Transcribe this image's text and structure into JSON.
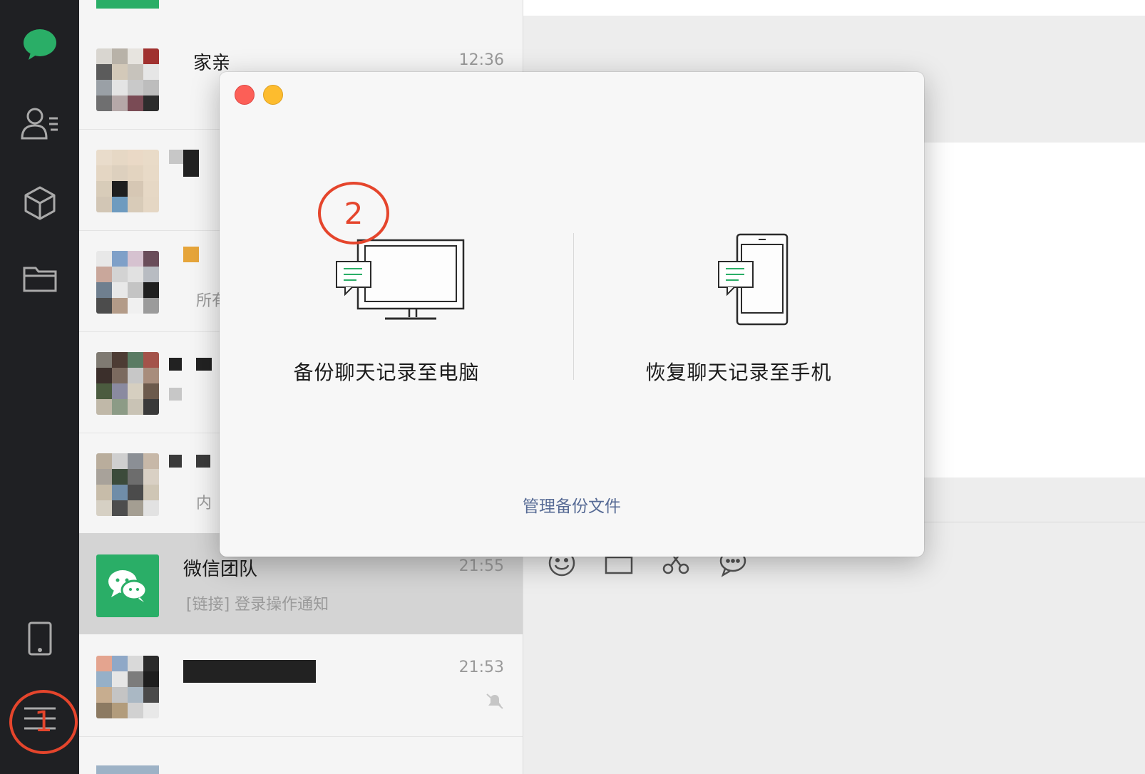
{
  "chat_list": [
    {
      "name": "家亲",
      "time": "12:36",
      "preview": ""
    },
    {
      "name": "",
      "time": "",
      "preview": ""
    },
    {
      "name": "",
      "time": "",
      "preview": "所有"
    },
    {
      "name": "",
      "time": "",
      "preview": ""
    },
    {
      "name": "",
      "time": "",
      "preview": "内"
    },
    {
      "name": "微信团队",
      "time": "21:55",
      "preview": "[链接] 登录操作通知",
      "selected": true
    },
    {
      "name": "",
      "time": "21:53",
      "preview": "",
      "muted": true
    }
  ],
  "dialog": {
    "option_backup": "备份聊天记录至电脑",
    "option_restore": "恢复聊天记录至手机",
    "manage_link": "管理备份文件"
  },
  "annotations": {
    "step1": "1",
    "step2": "2"
  },
  "colors": {
    "sidebar_bg": "#1f2023",
    "wechat_green": "#2aae67",
    "link_blue": "#576b95",
    "annotation_red": "#e5452c",
    "close_red": "#fc5f57",
    "minimize_yellow": "#fdbc2e"
  },
  "icons": {
    "sidebar": [
      "chat-icon",
      "contacts-icon",
      "mini-programs-icon",
      "files-icon",
      "phone-icon",
      "menu-icon"
    ],
    "toolbar": [
      "emoji-icon",
      "folder-icon",
      "scissors-icon",
      "chat-bubble-icon"
    ]
  }
}
